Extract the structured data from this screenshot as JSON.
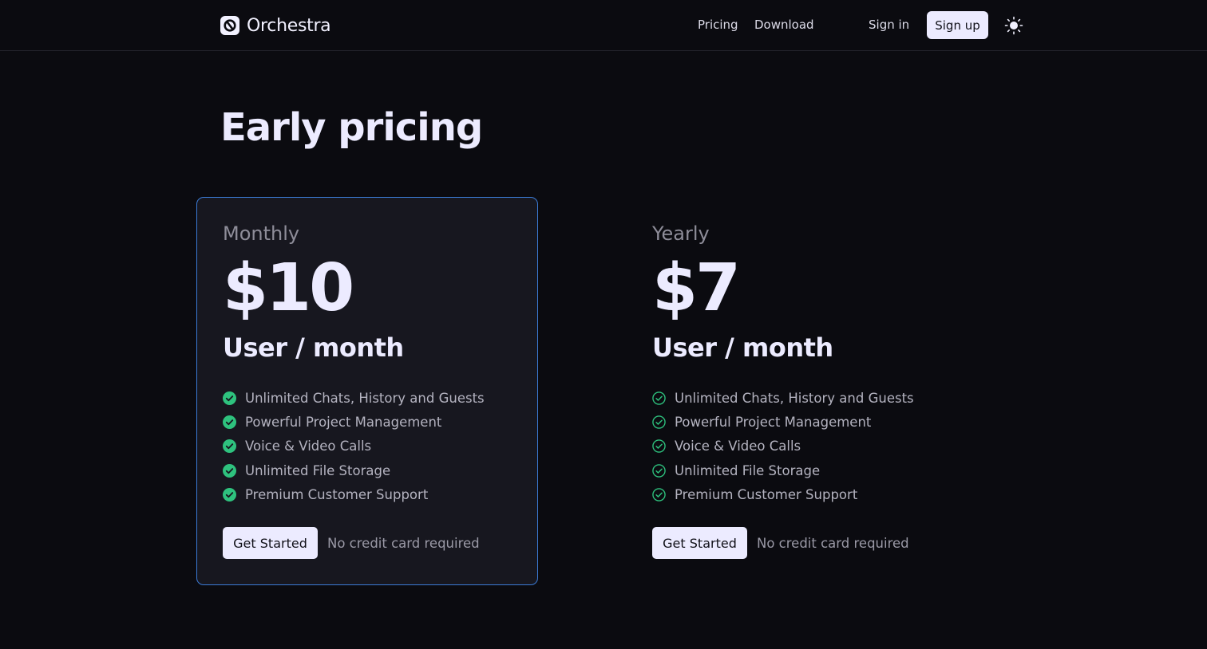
{
  "header": {
    "logo_text": "Orchestra",
    "nav": {
      "pricing": "Pricing",
      "download": "Download"
    },
    "sign_in": "Sign in",
    "sign_up": "Sign up",
    "theme_icon": "sun-icon"
  },
  "page": {
    "title": "Early pricing"
  },
  "plans": [
    {
      "name": "Monthly",
      "price": "$10",
      "unit": "User / month",
      "highlighted": true,
      "features": [
        "Unlimited Chats, History and Guests",
        "Powerful Project Management",
        "Voice & Video Calls",
        "Unlimited File Storage",
        "Premium Customer Support"
      ],
      "cta": "Get Started",
      "note": "No credit card required"
    },
    {
      "name": "Yearly",
      "price": "$7",
      "unit": "User / month",
      "highlighted": false,
      "features": [
        "Unlimited Chats, History and Guests",
        "Powerful Project Management",
        "Voice & Video Calls",
        "Unlimited File Storage",
        "Premium Customer Support"
      ],
      "cta": "Get Started",
      "note": "No credit card required"
    }
  ],
  "colors": {
    "background": "#0b0b10",
    "card_highlight_border": "#3b7bd6",
    "check_green": "#2ec27e",
    "button_bg": "#ecebff"
  }
}
